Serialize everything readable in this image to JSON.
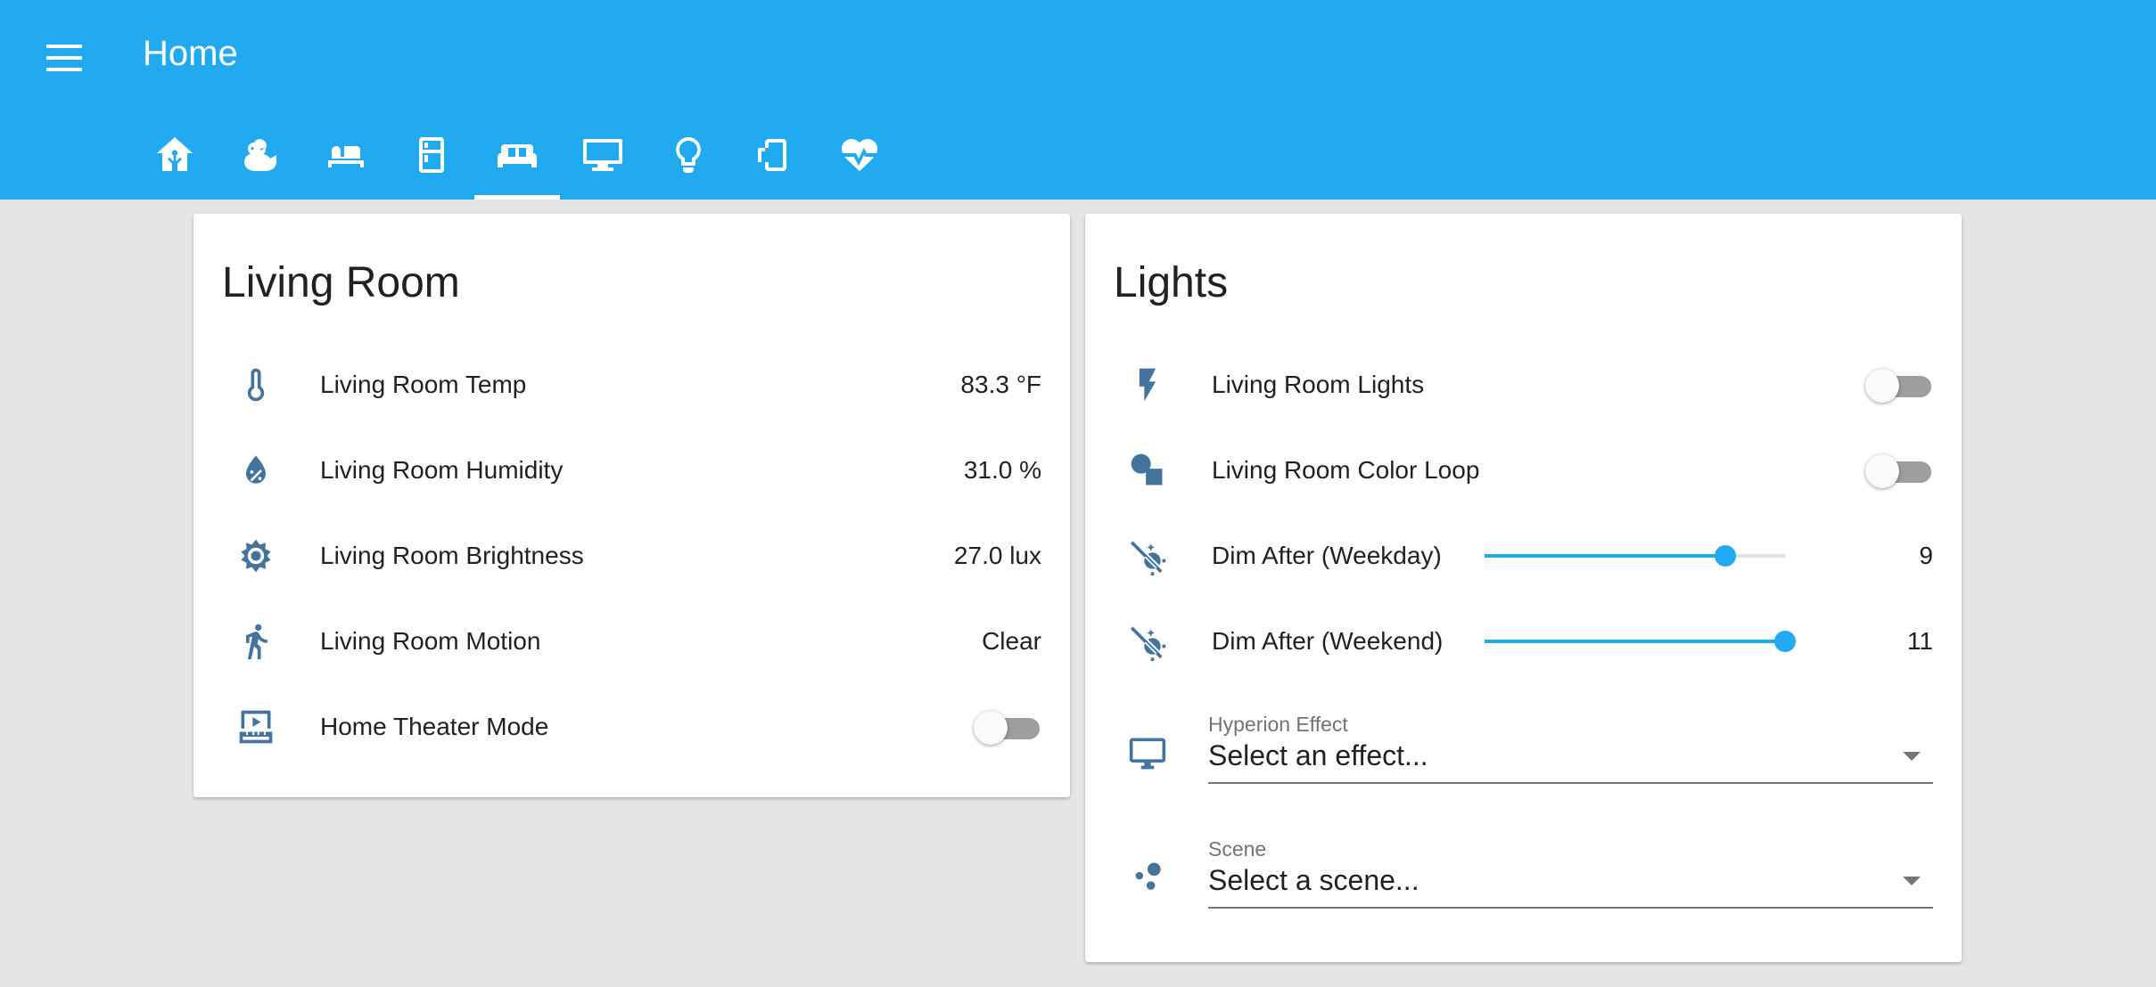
{
  "header": {
    "title": "Home",
    "tabs": [
      {
        "icon": "home-assistant-icon",
        "active": false
      },
      {
        "icon": "duck-icon",
        "active": false
      },
      {
        "icon": "hotel-bed-icon",
        "active": false
      },
      {
        "icon": "fridge-icon",
        "active": false
      },
      {
        "icon": "sofa-icon",
        "active": true
      },
      {
        "icon": "desktop-monitor-icon",
        "active": false
      },
      {
        "icon": "lightbulb-icon",
        "active": false
      },
      {
        "icon": "phone-rotate-icon",
        "active": false
      },
      {
        "icon": "heart-pulse-icon",
        "active": false
      }
    ]
  },
  "living_room": {
    "title": "Living Room",
    "rows": [
      {
        "icon": "thermometer-icon",
        "name": "Living Room Temp",
        "value": "83.3 °F"
      },
      {
        "icon": "water-percent-icon",
        "name": "Living Room Humidity",
        "value": "31.0 %"
      },
      {
        "icon": "brightness-icon",
        "name": "Living Room Brightness",
        "value": "27.0 lux"
      },
      {
        "icon": "walk-icon",
        "name": "Living Room Motion",
        "value": "Clear"
      },
      {
        "icon": "theater-icon",
        "name": "Home Theater Mode",
        "toggle": false
      }
    ]
  },
  "lights": {
    "title": "Lights",
    "toggles": [
      {
        "icon": "flash-icon",
        "name": "Living Room Lights",
        "on": false
      },
      {
        "icon": "shape-icon",
        "name": "Living Room Color Loop",
        "on": false
      }
    ],
    "sliders": [
      {
        "icon": "theme-light-dark-icon",
        "name": "Dim After (Weekday)",
        "value": "9",
        "level": 0.8
      },
      {
        "icon": "theme-light-dark-icon",
        "name": "Dim After (Weekend)",
        "value": "11",
        "level": 1.0
      }
    ],
    "selects": [
      {
        "icon": "monitor-icon",
        "label": "Hyperion Effect",
        "value": "Select an effect..."
      },
      {
        "icon": "scene-dots-icon",
        "label": "Scene",
        "value": "Select a scene..."
      }
    ]
  },
  "colors": {
    "header": "#22aaf0",
    "icon": "#44739e",
    "accent": "#22aaf0",
    "background": "#e5e5e5"
  }
}
